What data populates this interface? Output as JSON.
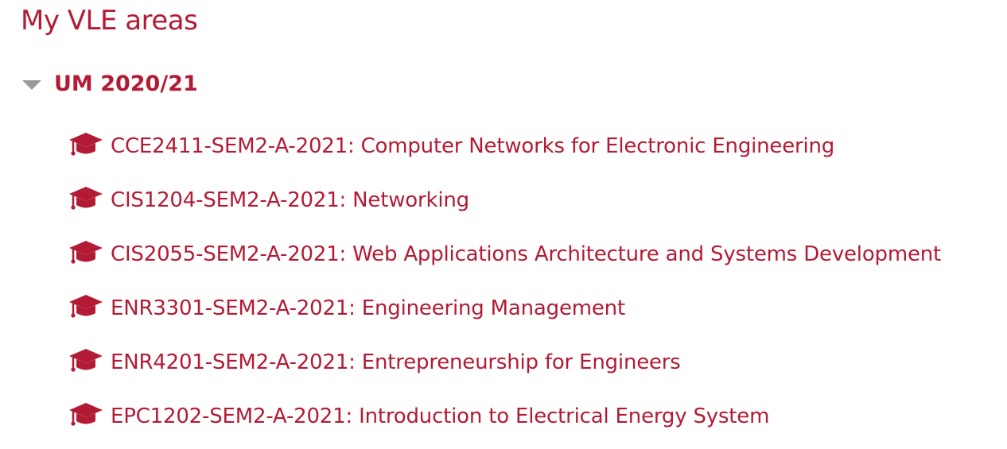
{
  "page": {
    "title": "My VLE areas"
  },
  "category": {
    "name": "UM 2020/21",
    "toggle_icon": "caret-down-icon",
    "expanded": true
  },
  "courses": [
    {
      "label": "CCE2411-SEM2-A-2021: Computer Networks for Electronic Engineering",
      "icon": "graduation-cap-icon"
    },
    {
      "label": "CIS1204-SEM2-A-2021: Networking",
      "icon": "graduation-cap-icon"
    },
    {
      "label": "CIS2055-SEM2-A-2021: Web Applications Architecture and Systems Development",
      "icon": "graduation-cap-icon"
    },
    {
      "label": "ENR3301-SEM2-A-2021: Engineering Management",
      "icon": "graduation-cap-icon"
    },
    {
      "label": "ENR4201-SEM2-A-2021: Entrepreneurship for Engineers",
      "icon": "graduation-cap-icon"
    },
    {
      "label": "EPC1202-SEM2-A-2021: Introduction to Electrical Energy System",
      "icon": "graduation-cap-icon"
    }
  ],
  "colors": {
    "accent": "#b31b34",
    "toggle": "#999999",
    "background": "#ffffff"
  }
}
